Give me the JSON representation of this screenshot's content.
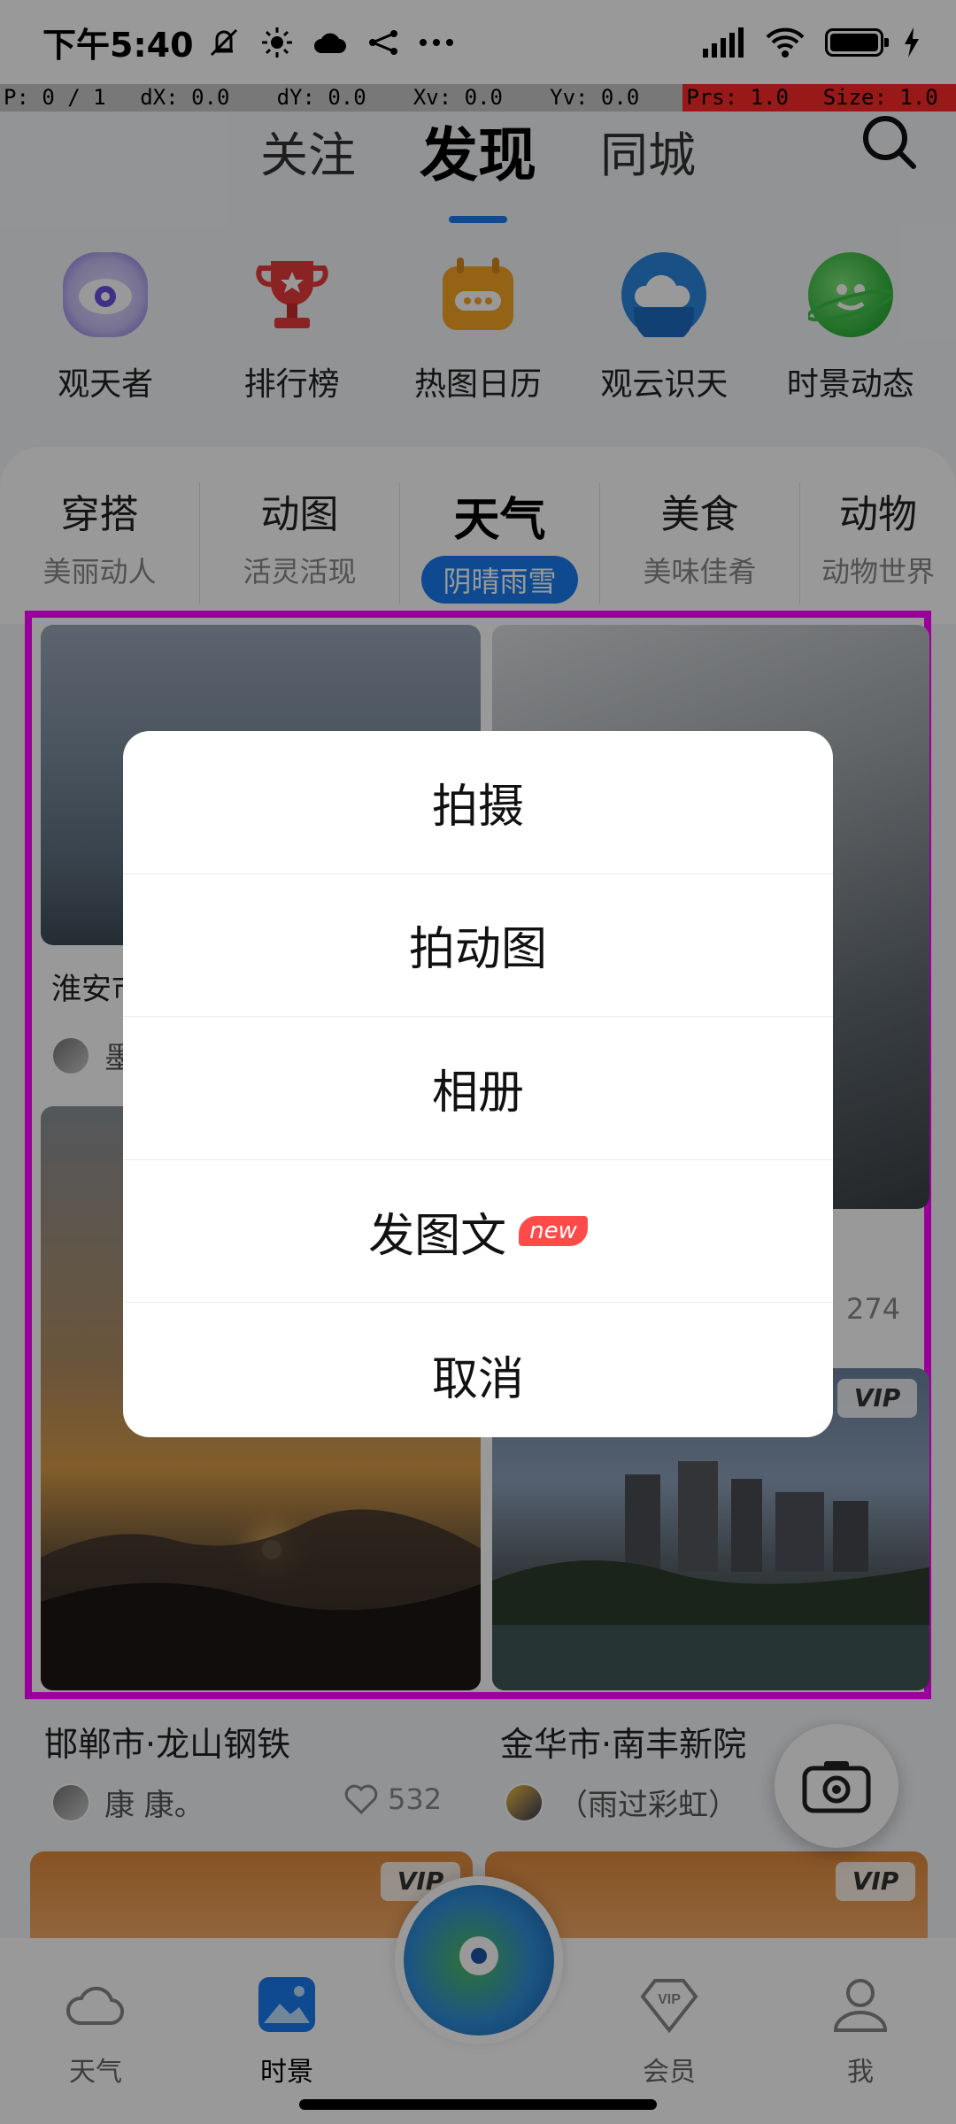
{
  "status_bar": {
    "time": "下午5:40",
    "left_icons": [
      "mute-icon",
      "sun-icon",
      "cloud-icon",
      "share-icon",
      "more-dots-icon"
    ],
    "right_icons": [
      "signal-icon",
      "wifi-icon",
      "battery-icon",
      "charging-icon"
    ]
  },
  "debug_bar": {
    "pointer": "P: 0 / 1",
    "dx": "dX: 0.0",
    "dy": "dY: 0.0",
    "xv": "Xv: 0.0",
    "yv": "Yv: 0.0",
    "prs": "Prs: 1.0",
    "size": "Size: 1.0"
  },
  "top_tabs": {
    "follow": "关注",
    "discover": "发现",
    "local": "同城"
  },
  "shortcuts": [
    {
      "label": "观天者",
      "icon": "eye-icon"
    },
    {
      "label": "排行榜",
      "icon": "trophy-icon"
    },
    {
      "label": "热图日历",
      "icon": "calendar-icon"
    },
    {
      "label": "观云识天",
      "icon": "cloud-icon"
    },
    {
      "label": "时景动态",
      "icon": "planet-icon"
    }
  ],
  "categories": [
    {
      "title": "穿搭",
      "subtitle": "美丽动人"
    },
    {
      "title": "动图",
      "subtitle": "活灵活现"
    },
    {
      "title": "天气",
      "subtitle": "阴晴雨雪"
    },
    {
      "title": "美食",
      "subtitle": "美味佳肴"
    },
    {
      "title": "动物",
      "subtitle": "动物世界"
    }
  ],
  "feed": {
    "post1_caption_partial": "淮安市",
    "post1_author_partial": "墨",
    "post2_count": "274",
    "vip_label": "VIP"
  },
  "below_feed": {
    "left_caption": "邯郸市·龙山钢铁",
    "left_author": "康 康。",
    "left_likes": "532",
    "right_caption": "金华市·南丰新院",
    "right_author": "（雨过彩虹）"
  },
  "bottom_nav": [
    {
      "label": "天气",
      "icon": "cloud-icon"
    },
    {
      "label": "时景",
      "icon": "image-icon"
    },
    {
      "label": "会员",
      "icon": "vip-diamond-icon"
    },
    {
      "label": "我",
      "icon": "person-icon"
    }
  ],
  "action_sheet": {
    "shoot": "拍摄",
    "shoot_gif": "拍动图",
    "album": "相册",
    "post_text": "发图文",
    "new_badge": "new",
    "cancel": "取消"
  },
  "colors": {
    "accent": "#1a7cf0",
    "highlight_frame": "#ff00ff",
    "debug_red": "#ff2b2b",
    "badge_red": "#ff4a4a"
  }
}
